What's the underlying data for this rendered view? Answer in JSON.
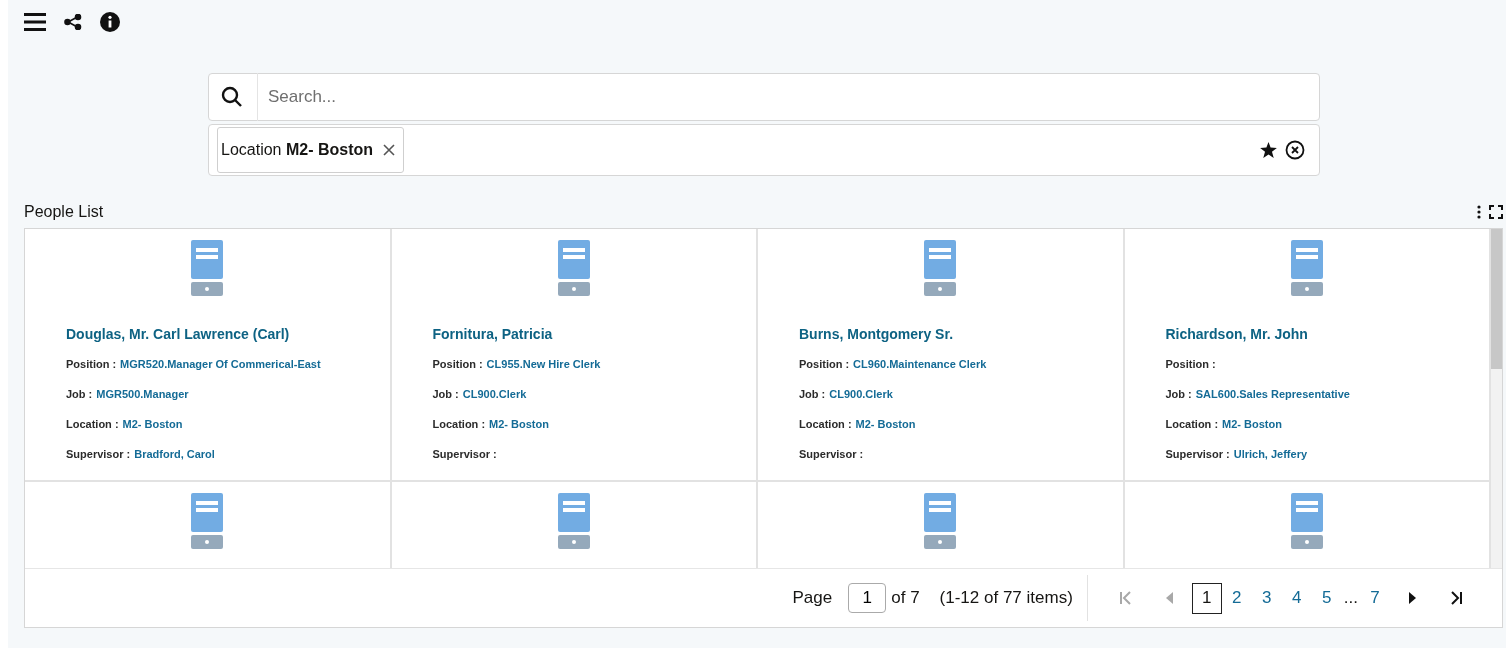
{
  "search": {
    "placeholder": "Search..."
  },
  "filters": [
    {
      "label": "Location",
      "value": "M2- Boston"
    }
  ],
  "list": {
    "title": "People List",
    "cards": [
      {
        "kind": "full",
        "name": "Douglas, Mr. Carl Lawrence (Carl)",
        "fields": [
          {
            "label": "Position :",
            "value": "MGR520.Manager Of Commerical-East"
          },
          {
            "label": "Job :",
            "value": "MGR500.Manager"
          },
          {
            "label": "Location :",
            "value": "M2- Boston"
          },
          {
            "label": "Supervisor :",
            "value": "Bradford, Carol"
          }
        ]
      },
      {
        "kind": "full",
        "name": "Fornitura, Patricia",
        "fields": [
          {
            "label": "Position :",
            "value": "CL955.New Hire Clerk"
          },
          {
            "label": "Job :",
            "value": "CL900.Clerk"
          },
          {
            "label": "Location :",
            "value": "M2- Boston"
          },
          {
            "label": "Supervisor :"
          }
        ]
      },
      {
        "kind": "full",
        "name": "Burns, Montgomery Sr.",
        "fields": [
          {
            "label": "Position :",
            "value": "CL960.Maintenance Clerk"
          },
          {
            "label": "Job :",
            "value": "CL900.Clerk"
          },
          {
            "label": "Location :",
            "value": "M2- Boston"
          },
          {
            "label": "Supervisor :"
          }
        ]
      },
      {
        "kind": "full",
        "name": "Richardson, Mr. John",
        "fields": [
          {
            "label": "Position :"
          },
          {
            "label": "Job :",
            "value": "SAL600.Sales Representative"
          },
          {
            "label": "Location :",
            "value": "M2- Boston"
          },
          {
            "label": "Supervisor :",
            "value": "Ulrich, Jeffery"
          }
        ]
      },
      {
        "kind": "partial"
      },
      {
        "kind": "partial"
      },
      {
        "kind": "partial"
      },
      {
        "kind": "partial"
      }
    ]
  },
  "pagination": {
    "label": "Page",
    "page": "1",
    "of": "of 7",
    "range": "(1-12 of 77 items)",
    "first": {
      "disabled": true
    },
    "prev": {
      "disabled": true
    },
    "pages": [
      {
        "label": "1",
        "selected": true
      },
      {
        "label": "2",
        "selected": false
      },
      {
        "label": "3",
        "selected": false
      },
      {
        "label": "4",
        "selected": false
      },
      {
        "label": "5",
        "selected": false
      },
      {
        "label": "...",
        "kind": "ellipsis"
      },
      {
        "label": "7",
        "selected": false
      }
    ],
    "next": {
      "disabled": false
    },
    "last": {
      "disabled": false
    }
  }
}
